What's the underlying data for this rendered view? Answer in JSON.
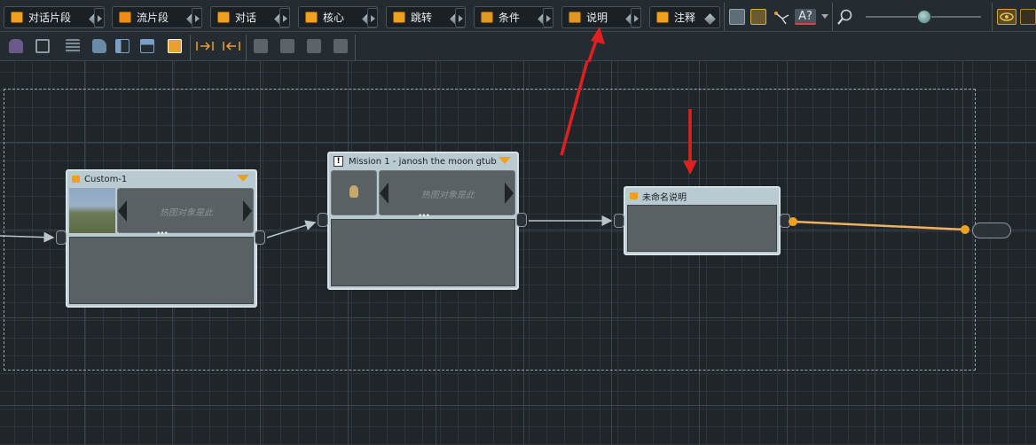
{
  "toolbar": {
    "buttons": [
      {
        "label": "对话片段",
        "color": "#f0a020"
      },
      {
        "label": "流片段",
        "color": "#f08c10"
      },
      {
        "label": "对话",
        "color": "#f0a020"
      },
      {
        "label": "核心",
        "color": "#f0a020"
      },
      {
        "label": "跳转",
        "color": "#f0a020"
      },
      {
        "label": "条件",
        "color": "#e09820"
      },
      {
        "label": "说明",
        "color": "#e09820"
      },
      {
        "label": "注释",
        "color": "#f0a020"
      }
    ],
    "icons": [
      "grid-view-icon",
      "node-select-icon",
      "connect-icon",
      "text-check-icon",
      "zoom-icon",
      "eye-icon"
    ],
    "text_check_label": "A?"
  },
  "toolbar2": {
    "icons": [
      "robot-icon",
      "monitor-icon",
      "list-icon",
      "paint-bucket-icon",
      "hierarchy-icon",
      "hierarchy2-icon",
      "export-icon",
      "align-left-icon",
      "align-right-icon",
      "stack1-icon",
      "stack2-icon",
      "stack3-icon",
      "stack4-icon"
    ]
  },
  "nodes": {
    "custom": {
      "title": "Custom-1",
      "slot_text": "热图对象是此",
      "dots": "•••"
    },
    "mission": {
      "title": "Mission 1 - janosh the moon gtub",
      "slot_text": "热图对象是此",
      "dots": "•••"
    },
    "note": {
      "title": "未命名说明"
    }
  },
  "colors": {
    "accent": "#f0a020",
    "annotation_arrow": "#e02020",
    "connection": "#b8c6cc",
    "orange_link": "#f0b060"
  }
}
